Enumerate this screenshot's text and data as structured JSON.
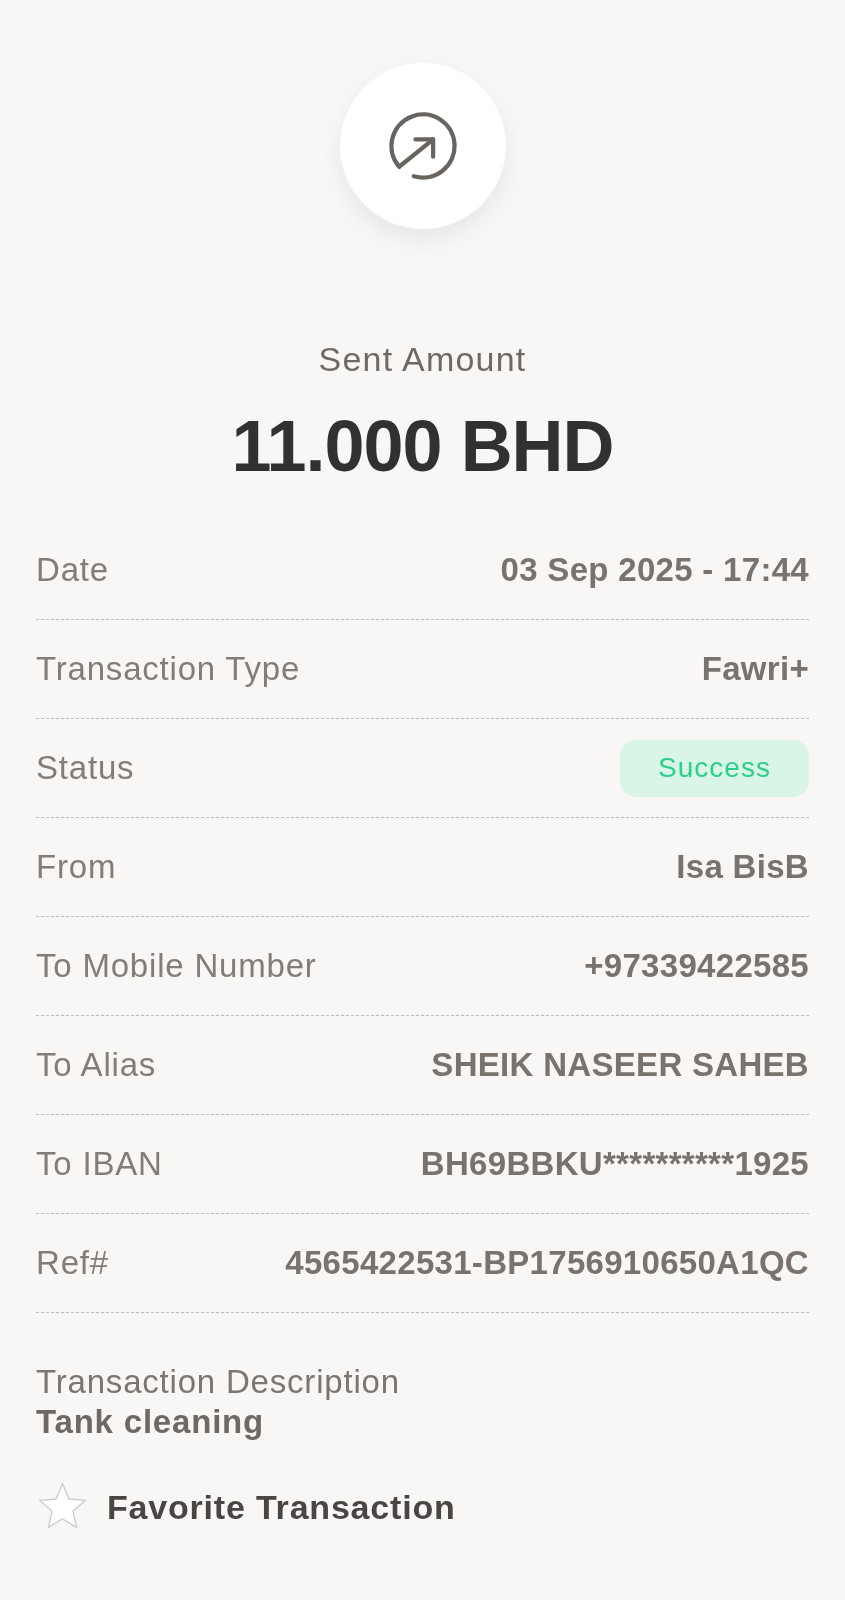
{
  "header": {
    "title": "Sent Amount",
    "amount": "11.000 BHD"
  },
  "details": [
    {
      "kind": "text",
      "label": "Date",
      "value": "03 Sep 2025 - 17:44"
    },
    {
      "kind": "text",
      "label": "Transaction Type",
      "value": "Fawri+"
    },
    {
      "kind": "status",
      "label": "Status",
      "value": "Success"
    },
    {
      "kind": "text",
      "label": "From",
      "value": "Isa BisB"
    },
    {
      "kind": "text",
      "label": "To Mobile Number",
      "value": "+97339422585"
    },
    {
      "kind": "text",
      "label": "To Alias",
      "value": "SHEIK NASEER SAHEB"
    },
    {
      "kind": "text",
      "label": "To IBAN",
      "value": "BH69BBKU**********1925"
    },
    {
      "kind": "text",
      "label": "Ref#",
      "value": "4565422531-BP1756910650A1QC"
    }
  ],
  "description": {
    "label": "Transaction Description",
    "value": "Tank cleaning"
  },
  "favorite": {
    "label": "Favorite Transaction",
    "checked": false
  }
}
